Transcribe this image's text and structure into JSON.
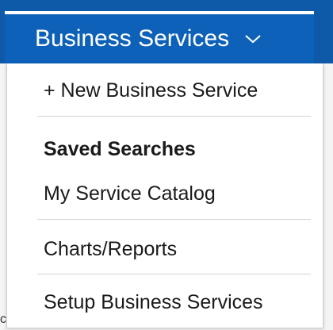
{
  "nav": {
    "trigger_label": "Business Services",
    "chevron_icon": "chevron-down-icon",
    "bar_color": "#0f5aa8",
    "trigger_color": "#0d61b8"
  },
  "menu": {
    "new_item": "+ New Business Service",
    "saved_searches_header": "Saved Searches",
    "my_service_catalog": "My Service Catalog",
    "charts_reports": "Charts/Reports",
    "setup": "Setup Business Services"
  },
  "background": {
    "partial_glyph": "c"
  }
}
